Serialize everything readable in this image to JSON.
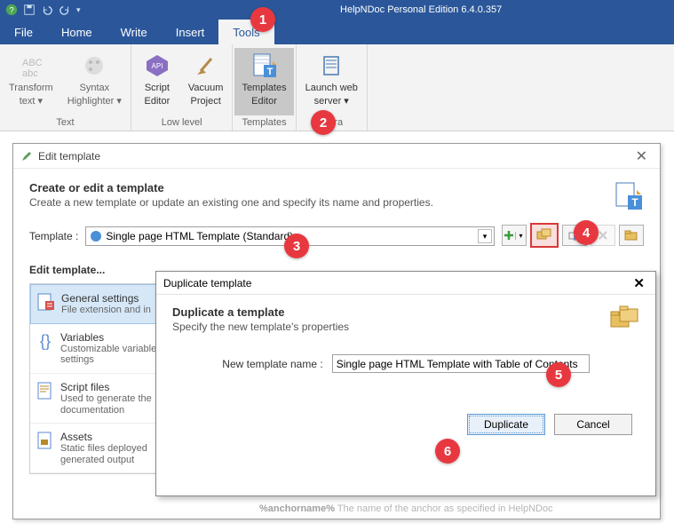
{
  "app": {
    "title": "HelpNDoc Personal Edition 6.4.0.357"
  },
  "menubar": {
    "file": "File",
    "home": "Home",
    "write": "Write",
    "insert": "Insert",
    "tools": "Tools"
  },
  "ribbon": {
    "text_group": "Text",
    "lowlevel_group": "Low level",
    "templates_group": "Templates",
    "extra_group": "Extra",
    "transform": {
      "l1": "Transform",
      "l2": "text ▾"
    },
    "syntax": {
      "l1": "Syntax",
      "l2": "Highlighter ▾"
    },
    "script": {
      "l1": "Script",
      "l2": "Editor"
    },
    "vacuum": {
      "l1": "Vacuum",
      "l2": "Project"
    },
    "templates_editor": {
      "l1": "Templates",
      "l2": "Editor"
    },
    "launch": {
      "l1": "Launch web",
      "l2": "server ▾"
    }
  },
  "edit_dialog": {
    "title": "Edit template",
    "heading": "Create or edit a template",
    "sub": "Create a new template or update an existing one and specify its name and properties.",
    "template_label": "Template :",
    "template_value": "Single page HTML Template (Standard)",
    "section_label": "Edit template...",
    "items": [
      {
        "title": "General settings",
        "sub": "File extension and in"
      },
      {
        "title": "Variables",
        "sub": "Customizable variable settings"
      },
      {
        "title": "Script files",
        "sub": "Used to generate the documentation"
      },
      {
        "title": "Assets",
        "sub": "Static files deployed generated output"
      }
    ]
  },
  "dup_dialog": {
    "title": "Duplicate template",
    "heading": "Duplicate a template",
    "sub": "Specify the new template's properties",
    "name_label": "New template name :",
    "name_value": "Single page HTML Template with Table of Contents",
    "ok": "Duplicate",
    "cancel": "Cancel"
  },
  "callouts": {
    "c1": "1",
    "c2": "2",
    "c3": "3",
    "c4": "4",
    "c5": "5",
    "c6": "6"
  },
  "footer_hint": {
    "b": "%anchorname%",
    "t": "  The name of the anchor as specified in HelpNDoc"
  }
}
